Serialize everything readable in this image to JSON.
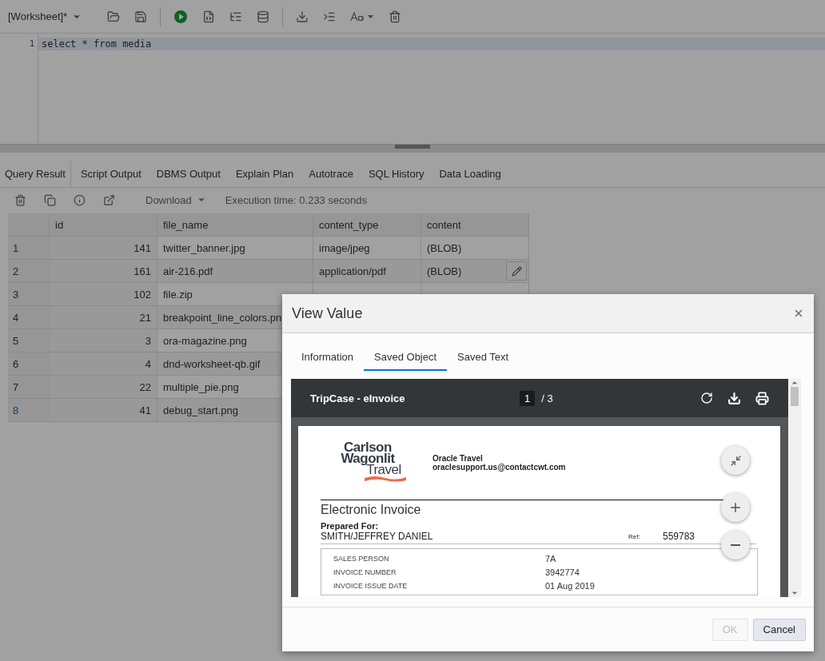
{
  "worksheet": {
    "title": "[Worksheet]*"
  },
  "editor": {
    "lines": [
      {
        "number": "1",
        "code": "select * from media",
        "current": true
      }
    ]
  },
  "result_tabs": [
    {
      "label": "Query Result",
      "selected": true
    },
    {
      "label": "Script Output",
      "selected": false
    },
    {
      "label": "DBMS Output",
      "selected": false
    },
    {
      "label": "Explain Plan",
      "selected": false
    },
    {
      "label": "Autotrace",
      "selected": false
    },
    {
      "label": "SQL History",
      "selected": false
    },
    {
      "label": "Data Loading",
      "selected": false
    }
  ],
  "result_toolbar": {
    "download": "Download",
    "execution_time": "Execution time: 0.233 seconds"
  },
  "table": {
    "columns": [
      "id",
      "file_name",
      "content_type",
      "content"
    ],
    "rows": [
      {
        "row": "1",
        "cells": [
          "141",
          "twitter_banner.jpg",
          "image/jpeg",
          "(BLOB)"
        ],
        "selected": false,
        "editable": false
      },
      {
        "row": "2",
        "cells": [
          "161",
          "air-216.pdf",
          "application/pdf",
          "(BLOB)"
        ],
        "selected": false,
        "editable": true
      },
      {
        "row": "3",
        "cells": [
          "102",
          "file.zip"
        ],
        "selected": false,
        "editable": false
      },
      {
        "row": "4",
        "cells": [
          "21",
          "breakpoint_line_colors.pn"
        ],
        "selected": false
      },
      {
        "row": "5",
        "cells": [
          "3",
          "ora-magazine.png"
        ],
        "selected": false
      },
      {
        "row": "6",
        "cells": [
          "4",
          "dnd-worksheet-qb.gif"
        ],
        "selected": false
      },
      {
        "row": "7",
        "cells": [
          "22",
          "multiple_pie.png"
        ],
        "selected": false
      },
      {
        "row": "8",
        "cells": [
          "41",
          "debug_start.png"
        ],
        "selected": true
      }
    ]
  },
  "dialog": {
    "title": "View Value",
    "tabs": [
      {
        "label": "Information",
        "selected": false
      },
      {
        "label": "Saved Object",
        "selected": true
      },
      {
        "label": "Saved Text",
        "selected": false
      }
    ],
    "viewer": {
      "title": "TripCase - eInvoice",
      "page": "1",
      "page_total": "/ 3",
      "document": {
        "logo": [
          "Carlson",
          "Wagonlit",
          "Travel"
        ],
        "company": "Oracle Travel",
        "email": "oraclesupport.us@contactcwt.com",
        "heading": "Electronic Invoice",
        "prepared_label": "Prepared For:",
        "customer": "SMITH/JEFFREY DANIEL",
        "ref_label": "Ref:",
        "ref": "559783",
        "details": [
          {
            "label": "SALES PERSON",
            "value": "7A"
          },
          {
            "label": "INVOICE NUMBER",
            "value": "3942774"
          },
          {
            "label": "INVOICE ISSUE DATE",
            "value": "01 Aug 2019"
          }
        ]
      }
    },
    "buttons": [
      {
        "label": "OK",
        "disabled": true
      },
      {
        "label": "Cancel",
        "disabled": false
      }
    ]
  }
}
